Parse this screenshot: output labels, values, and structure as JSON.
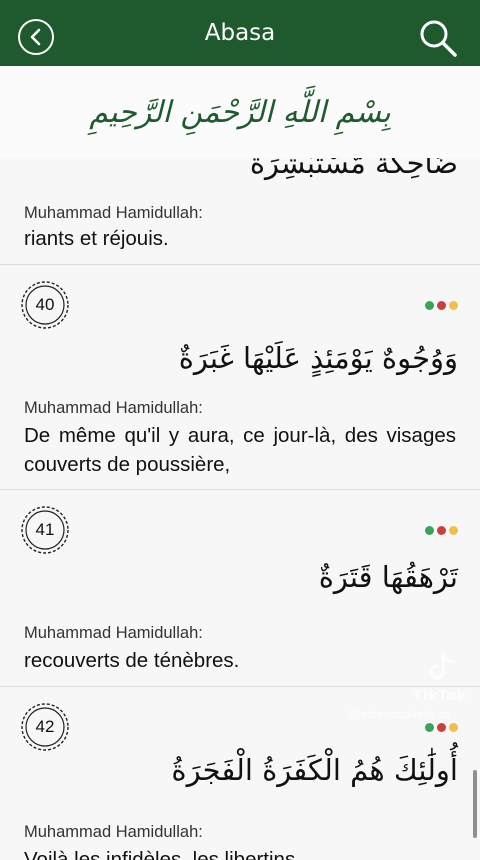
{
  "header": {
    "title": "Abasa"
  },
  "bismillah": "بِسْمِ اللَّهِ الرَّحْمَنِ الرَّحِيمِ",
  "verses": [
    {
      "arabic": "ضَاحِكَةٌ مُّسْتَبْشِرَةٌ",
      "translator": "Muhammad Hamidullah:",
      "translation": "riants et réjouis."
    },
    {
      "number": "40",
      "arabic": "وَوُجُوهٌ يَوْمَئِذٍ عَلَيْهَا غَبَرَةٌ",
      "translator": "Muhammad Hamidullah:",
      "translation": "De même qu'il y aura, ce jour-là, des visages couverts de poussière,"
    },
    {
      "number": "41",
      "arabic": "تَرْهَقُهَا قَتَرَةٌ",
      "translator": "Muhammad Hamidullah:",
      "translation": "recouverts de ténèbres."
    },
    {
      "number": "42",
      "arabic": "أُولَٰئِكَ هُمُ الْكَفَرَةُ الْفَجَرَةُ",
      "translator": "Muhammad Hamidullah:",
      "translation": "Voilà les infidèles, les libertins."
    }
  ],
  "watermark": {
    "brand": "TikTok",
    "handle": "@albanouallaih_zz"
  },
  "colors": {
    "header_green": "#1f5a2e",
    "dot_green": "#3aa35b",
    "dot_red": "#c9413b",
    "dot_yellow": "#f0c04a"
  }
}
